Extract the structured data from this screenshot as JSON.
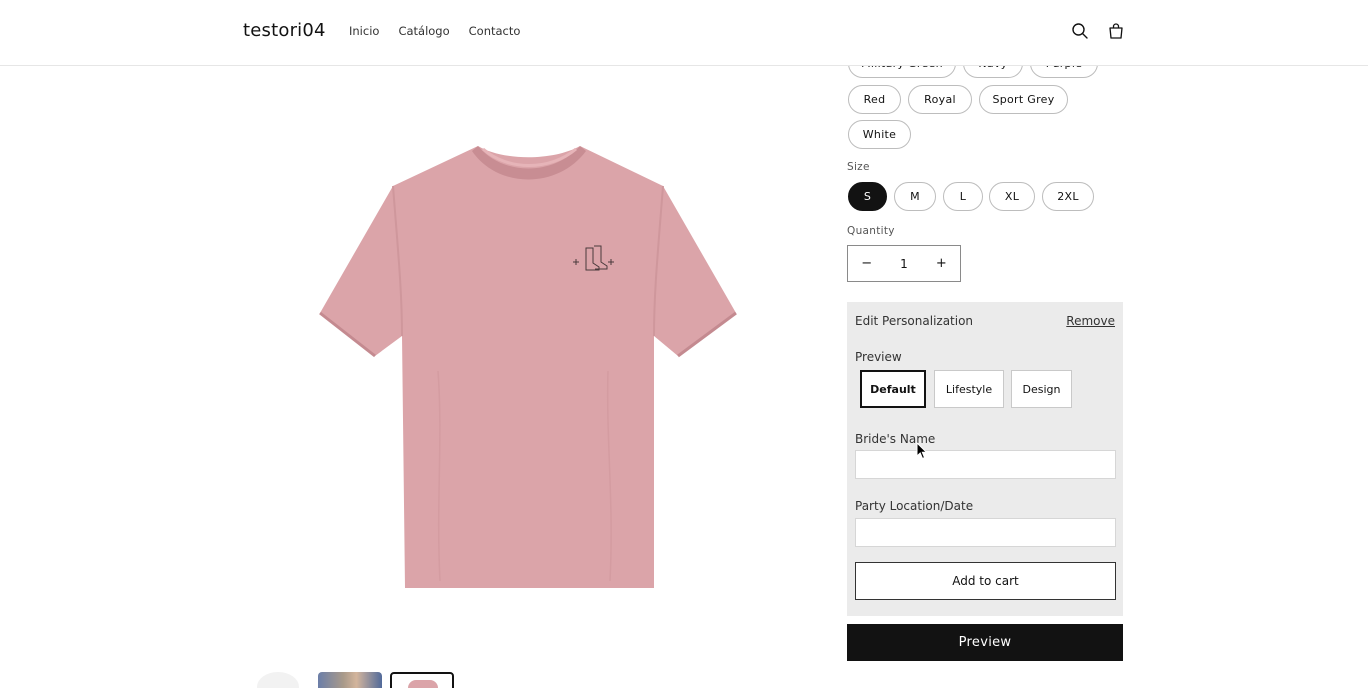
{
  "header": {
    "brand": "testori04",
    "nav": [
      "Inicio",
      "Catálogo",
      "Contacto"
    ],
    "icons": [
      "search-icon",
      "cart-icon"
    ]
  },
  "product": {
    "image": "pink-tshirt-with-cowboy-boots-print",
    "colors_row1": [
      "Military Green",
      "Navy",
      "Purple"
    ],
    "colors_row2": [
      "Red",
      "Royal",
      "Sport Grey"
    ],
    "colors_row3": [
      "White"
    ],
    "size_label": "Size",
    "sizes": [
      "S",
      "M",
      "L",
      "XL",
      "2XL"
    ],
    "selected_size": "S",
    "quantity_label": "Quantity",
    "quantity": "1",
    "qty_minus": "−",
    "qty_plus": "+"
  },
  "personalization": {
    "title": "Edit Personalization",
    "remove": "Remove",
    "preview_label": "Preview",
    "tabs": [
      "Default",
      "Lifestyle",
      "Design"
    ],
    "field1_label": "Bride's Name",
    "field1_value": "",
    "field2_label": "Party Location/Date",
    "field2_value": "",
    "add_to_cart": "Add to cart"
  },
  "preview_button": "Preview",
  "colors": {
    "shirt": "#dba4a9",
    "accent": "#121212",
    "panel_bg": "#ebebeb"
  }
}
